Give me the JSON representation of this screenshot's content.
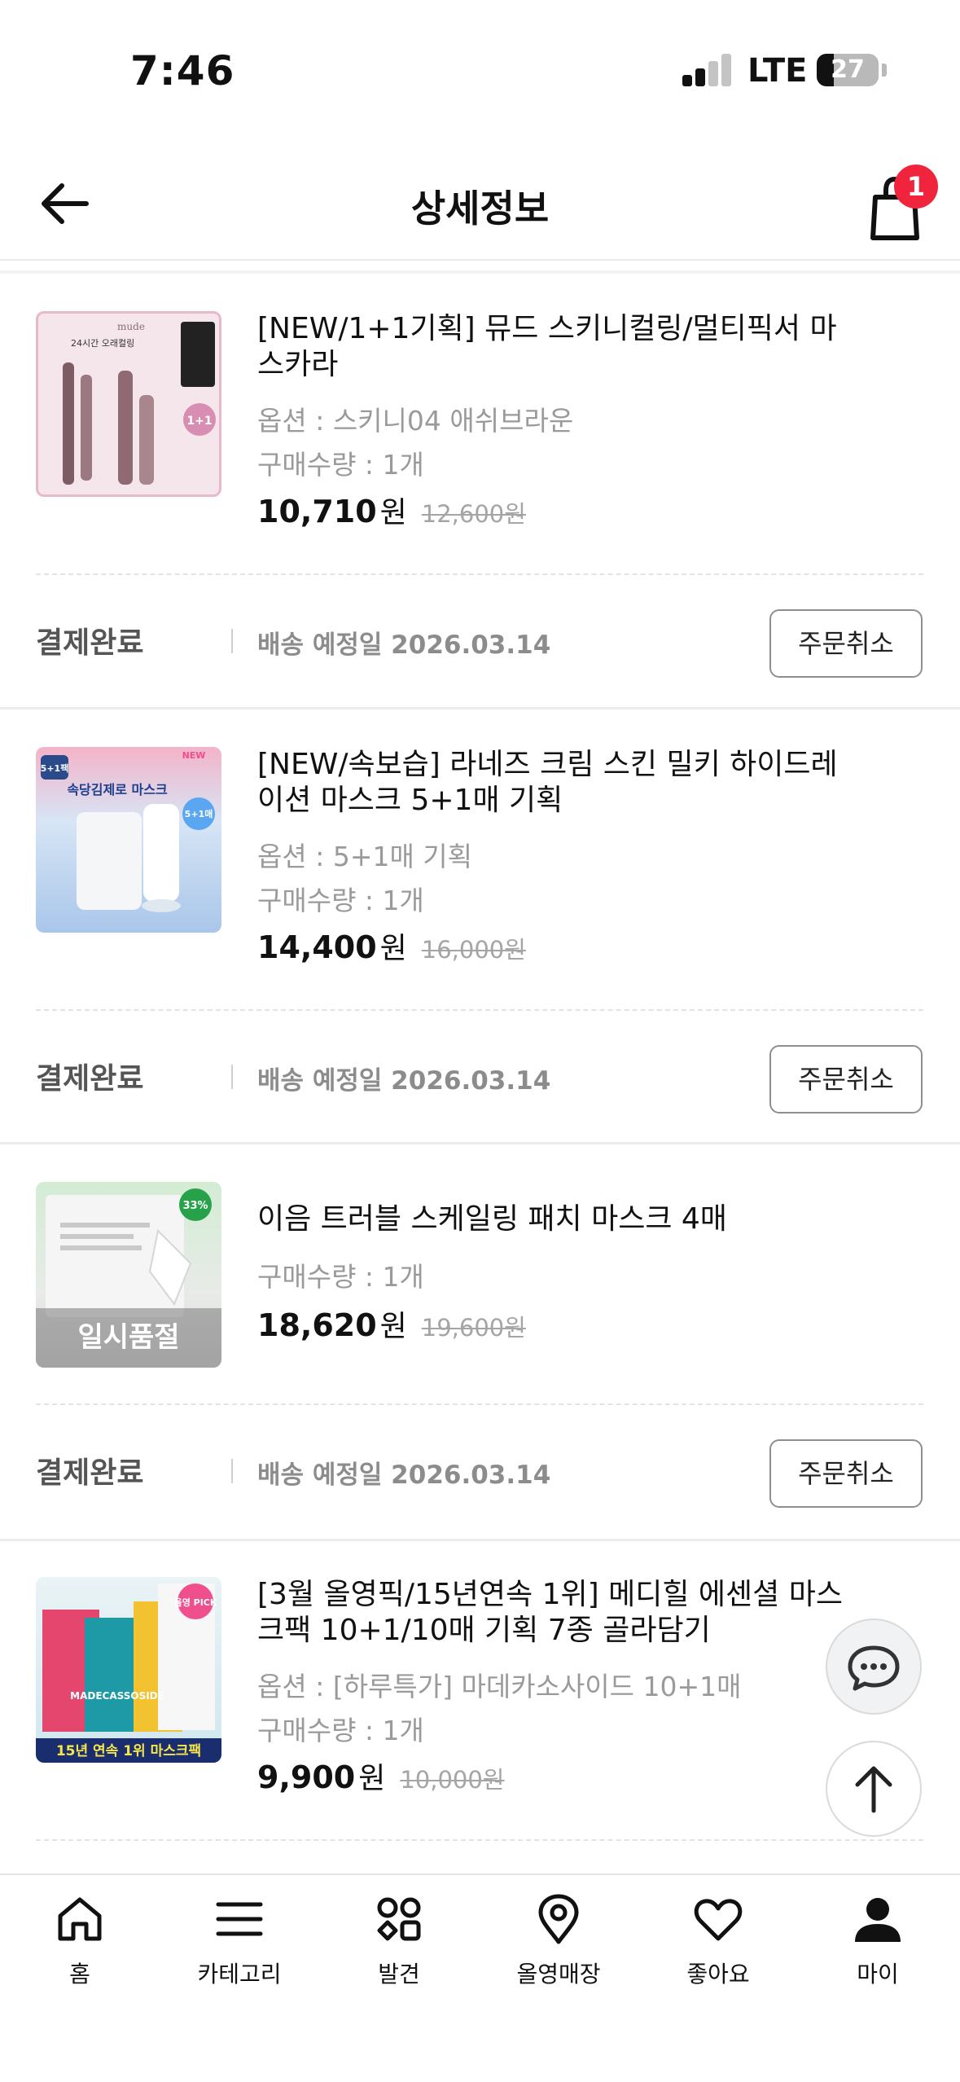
{
  "status_bar": {
    "time": "7:46",
    "network": "LTE",
    "battery": "27",
    "battery_level": 0.27
  },
  "header": {
    "title": "상세정보",
    "cart_count": "1"
  },
  "orders": [
    {
      "name": "[NEW/1+1기획] 뮤드 스키니컬링/멀티픽서 마스카라",
      "option": "옵션 : 스키니04 애쉬브라운",
      "quantity": "구매수량 : 1개",
      "price": "10,710",
      "currency": "원",
      "original_price": "12,600원",
      "status": "결제완료",
      "delivery": "배송 예정일 2026.03.14",
      "cancel_label": "주문취소",
      "image_text": [
        "mude",
        "24시간 오래컬링",
        "1+1"
      ]
    },
    {
      "name": "[NEW/속보습] 라네즈 크림 스킨 밀키 하이드레이션 마스크 5+1매 기획",
      "option": "옵션 : 5+1매 기획",
      "quantity": "구매수량 : 1개",
      "price": "14,400",
      "currency": "원",
      "original_price": "16,000원",
      "status": "결제완료",
      "delivery": "배송 예정일 2026.03.14",
      "cancel_label": "주문취소",
      "image_text": [
        "5+1팩",
        "속당김제로 마스크",
        "NEW",
        "5+1매"
      ]
    },
    {
      "name": "이음 트러블 스케일링 패치 마스크 4매",
      "quantity": "구매수량 : 1개",
      "price": "18,620",
      "currency": "원",
      "original_price": "19,600원",
      "status": "결제완료",
      "delivery": "배송 예정일 2026.03.14",
      "cancel_label": "주문취소",
      "image_text": [
        "33%",
        "일시품절"
      ]
    },
    {
      "name": "[3월 올영픽/15년연속 1위] 메디힐 에센셜 마스크팩 10+1/10매 기획 7종 골라담기",
      "option": "옵션 : [하루특가] 마데카소사이드 10+1매",
      "quantity": "구매수량 : 1개",
      "price": "9,900",
      "currency": "원",
      "original_price": "10,000원",
      "image_text": [
        "올영 PICK",
        "MADECASSOSIDE",
        "15년 연속 1위 마스크팩"
      ]
    }
  ],
  "bottom_nav": [
    {
      "label": "홈",
      "icon": "home-icon"
    },
    {
      "label": "카테고리",
      "icon": "menu-icon"
    },
    {
      "label": "발견",
      "icon": "discover-icon"
    },
    {
      "label": "올영매장",
      "icon": "location-pin-icon"
    },
    {
      "label": "좋아요",
      "icon": "heart-icon"
    },
    {
      "label": "마이",
      "icon": "user-icon"
    }
  ]
}
